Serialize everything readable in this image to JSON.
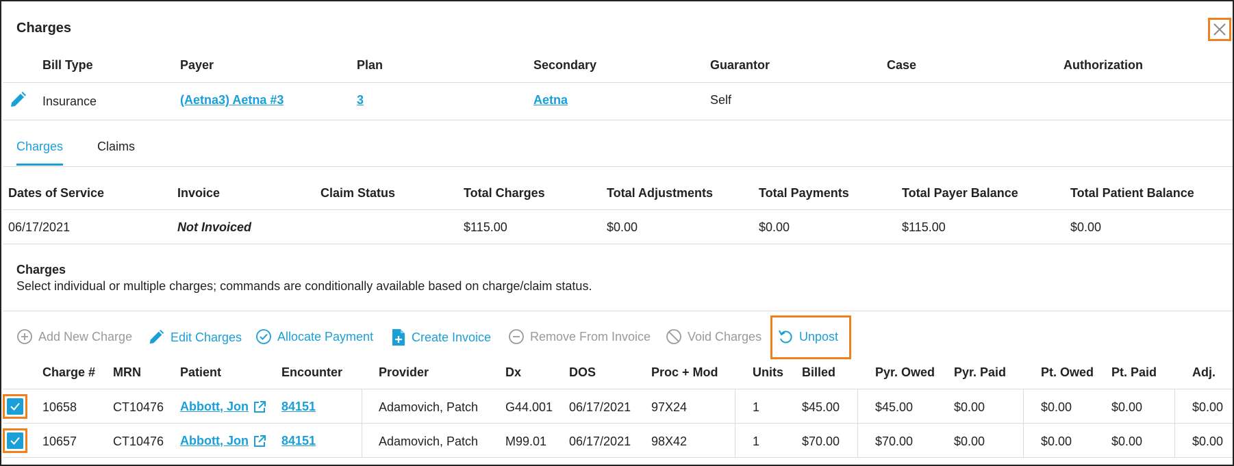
{
  "dialog": {
    "title": "Charges"
  },
  "billing": {
    "headers": [
      "Bill Type",
      "Payer",
      "Plan",
      "Secondary",
      "Guarantor",
      "Case",
      "Authorization"
    ],
    "row": {
      "bill_type": "Insurance",
      "payer": "(Aetna3) Aetna #3",
      "plan": "3",
      "secondary": "Aetna",
      "guarantor": "Self",
      "case": "",
      "authorization": ""
    }
  },
  "tabs": [
    {
      "label": "Charges",
      "active": true
    },
    {
      "label": "Claims",
      "active": false
    }
  ],
  "summary": {
    "headers": [
      "Dates of Service",
      "Invoice",
      "Claim Status",
      "Total Charges",
      "Total Adjustments",
      "Total Payments",
      "Total Payer Balance",
      "Total Patient Balance"
    ],
    "row": {
      "dates_of_service": "06/17/2021",
      "invoice": "Not Invoiced",
      "claim_status": "",
      "total_charges": "$115.00",
      "total_adjustments": "$0.00",
      "total_payments": "$0.00",
      "total_payer_balance": "$115.00",
      "total_patient_balance": "$0.00"
    }
  },
  "charges_section": {
    "title": "Charges",
    "description": "Select individual or multiple charges; commands are conditionally available based on charge/claim status."
  },
  "toolbar": {
    "add_new_charge": "Add New Charge",
    "edit_charges": "Edit Charges",
    "allocate_payment": "Allocate Payment",
    "create_invoice": "Create Invoice",
    "remove_from_invoice": "Remove From Invoice",
    "void_charges": "Void Charges",
    "unpost": "Unpost"
  },
  "charges_table": {
    "headers": [
      "Charge #",
      "MRN",
      "Patient",
      "Encounter",
      "Provider",
      "Dx",
      "DOS",
      "Proc + Mod",
      "Units",
      "Billed",
      "Pyr. Owed",
      "Pyr. Paid",
      "Pt. Owed",
      "Pt. Paid",
      "Adj."
    ],
    "rows": [
      {
        "charge": "10658",
        "mrn": "CT10476",
        "patient": "Abbott, Jon",
        "encounter": "84151",
        "provider": "Adamovich, Patch",
        "dx": "G44.001",
        "dos": "06/17/2021",
        "proc": "97X24",
        "units": "1",
        "billed": "$45.00",
        "pyr_owed": "$45.00",
        "pyr_paid": "$0.00",
        "pt_owed": "$0.00",
        "pt_paid": "$0.00",
        "adj": "$0.00"
      },
      {
        "charge": "10657",
        "mrn": "CT10476",
        "patient": "Abbott, Jon",
        "encounter": "84151",
        "provider": "Adamovich, Patch",
        "dx": "M99.01",
        "dos": "06/17/2021",
        "proc": "98X42",
        "units": "1",
        "billed": "$70.00",
        "pyr_owed": "$70.00",
        "pyr_paid": "$0.00",
        "pt_owed": "$0.00",
        "pt_paid": "$0.00",
        "adj": "$0.00"
      }
    ]
  },
  "colors": {
    "accent": "#1a9fd6",
    "highlight": "#f07f1f",
    "muted": "#9a9a9a"
  }
}
